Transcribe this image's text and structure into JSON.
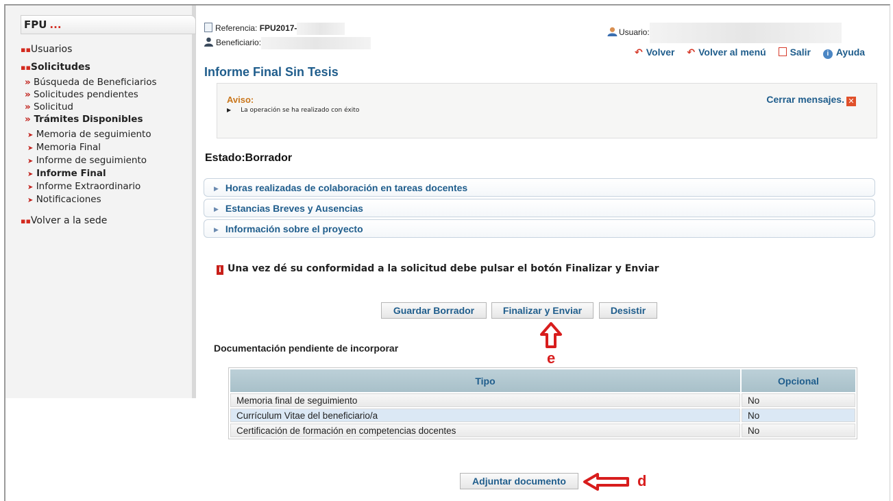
{
  "sidebar": {
    "app_title": "FPU",
    "app_title_dots": "...",
    "usuarios": "Usuarios",
    "solicitudes": "Solicitudes",
    "sub": [
      "Búsqueda de Beneficiarios",
      "Solicitudes pendientes",
      "Solicitud",
      "Trámites Disponibles"
    ],
    "tramites": [
      "Memoria de seguimiento",
      "Memoria Final",
      "Informe de seguimiento",
      "Informe Final",
      "Informe Extraordinario",
      "Notificaciones"
    ],
    "volver_sede": "Volver a la sede"
  },
  "header": {
    "referencia_label": "Referencia:",
    "referencia_value": "FPU2017-",
    "beneficiario_label": "Beneficiario:",
    "usuario_label": "Usuario:"
  },
  "nav": {
    "volver": "Volver",
    "volver_menu": "Volver al menú",
    "salir": "Salir",
    "ayuda": "Ayuda"
  },
  "page": {
    "title": "Informe Final Sin Tesis",
    "estado": "Estado:Borrador"
  },
  "aviso": {
    "title": "Aviso:",
    "message": "La operación se ha realizado con éxito",
    "close": "Cerrar mensajes."
  },
  "sections": [
    "Horas realizadas de colaboración en tareas docentes",
    "Estancias Breves y Ausencias",
    "Información sobre el proyecto"
  ],
  "notice": "Una vez dé su conformidad a la solicitud debe pulsar el botón Finalizar y Enviar",
  "buttons": {
    "guardar": "Guardar Borrador",
    "finalizar": "Finalizar y Enviar",
    "desistir": "Desistir",
    "adjuntar": "Adjuntar documento"
  },
  "annotations": {
    "e": "e",
    "d": "d"
  },
  "docs": {
    "heading": "Documentación pendiente de incorporar",
    "columns": [
      "Tipo",
      "Opcional"
    ],
    "rows": [
      [
        "Memoria final de seguimiento",
        "No"
      ],
      [
        "Currículum Vitae del beneficiario/a",
        "No"
      ],
      [
        "Certificación de formación en competencias docentes",
        "No"
      ]
    ]
  },
  "colors": {
    "link_blue": "#1f5d8c",
    "accent_red": "#d32a1f",
    "aviso_orange": "#c9761b"
  }
}
